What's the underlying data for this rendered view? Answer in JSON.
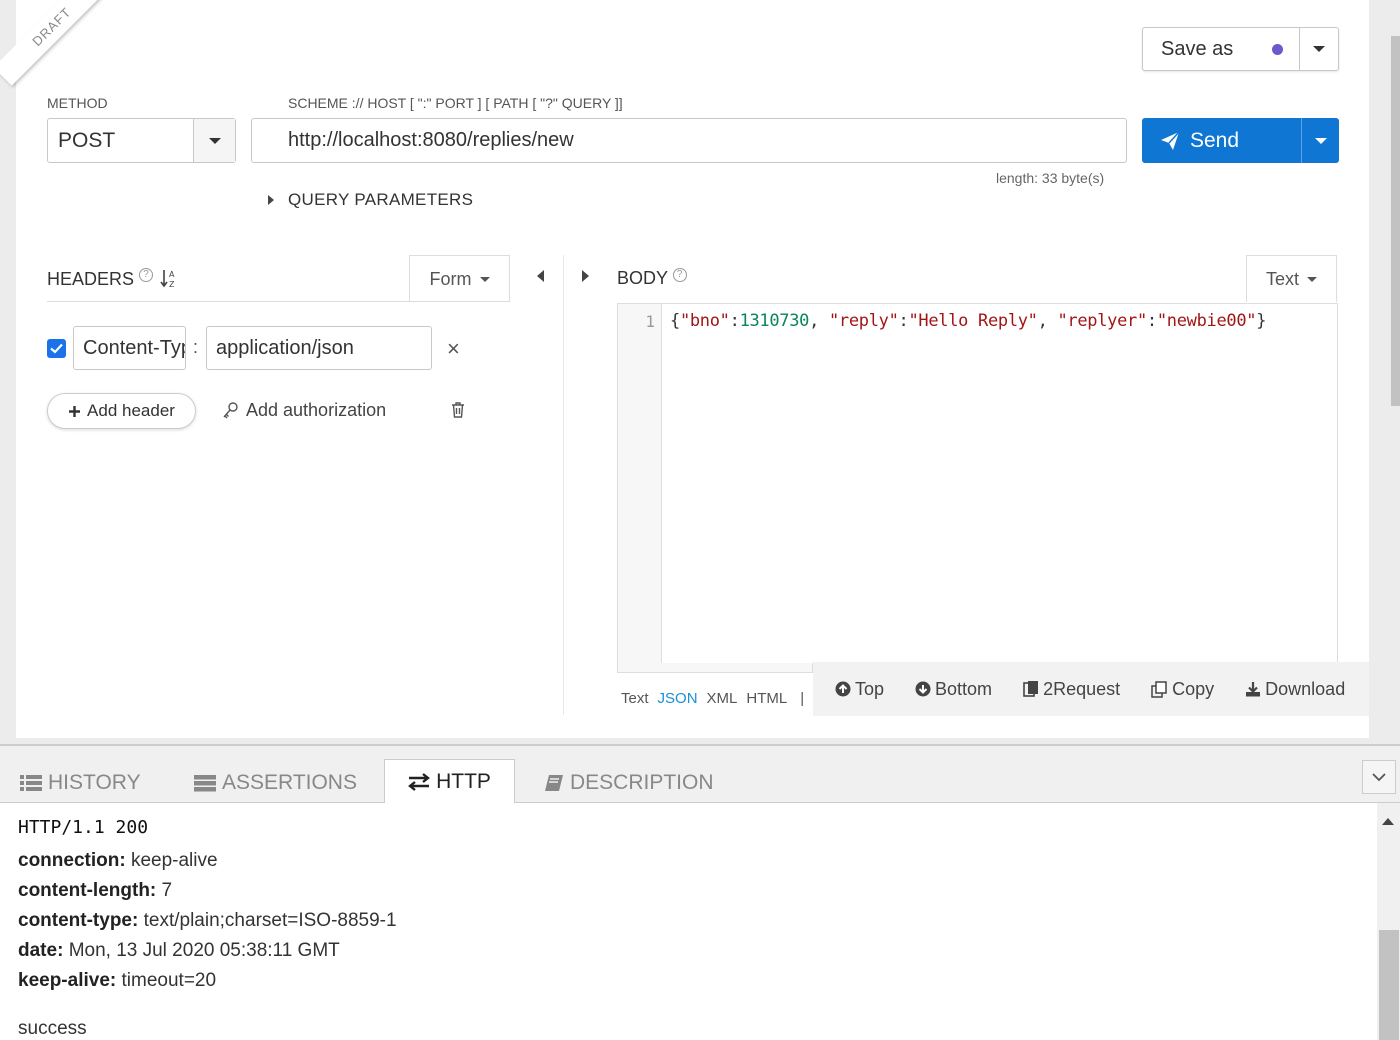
{
  "draft_label": "DRAFT",
  "save": {
    "label": "Save as",
    "dot_color": "#6a5acd"
  },
  "request": {
    "method_label": "METHOD",
    "method_value": "POST",
    "url_label": "SCHEME :// HOST [ \":\" PORT ] [ PATH [ \"?\" QUERY ]]",
    "url_value": "http://localhost:8080/replies/new",
    "length_text": "length: 33 byte(s)",
    "send_label": "Send",
    "query_params_label": "QUERY PARAMETERS"
  },
  "headers": {
    "title": "HEADERS",
    "help": "?",
    "form_label": "Form",
    "items": [
      {
        "checked": true,
        "name": "Content-Type",
        "value": "application/json"
      }
    ],
    "separator": ":",
    "remove_glyph": "×",
    "add_header_label": "Add header",
    "add_auth_label": "Add authorization"
  },
  "body": {
    "title": "BODY",
    "help": "?",
    "format_label": "Text",
    "line_number": "1",
    "code": {
      "p1": "{",
      "k1": "\"bno\"",
      "c1": ":",
      "v1": "1310730",
      "s1": ", ",
      "k2": "\"reply\"",
      "c2": ":",
      "v2": "\"Hello Reply\"",
      "s2": ", ",
      "k3": "\"replyer\"",
      "c3": ":",
      "v3": "\"newbie00\"",
      "p2": "}"
    },
    "modes": [
      "Text",
      "JSON",
      "XML",
      "HTML",
      "|"
    ],
    "active_mode": "JSON",
    "toolbar": {
      "top": "Top",
      "bottom": "Bottom",
      "to_request": "2Request",
      "copy": "Copy",
      "download": "Download"
    }
  },
  "tabs": {
    "history": "HISTORY",
    "assertions": "ASSERTIONS",
    "http": "HTTP",
    "description": "DESCRIPTION",
    "active": "HTTP"
  },
  "response": {
    "status_line": "HTTP/1.1 200",
    "headers": [
      {
        "name": "connection:",
        "value": "keep-alive"
      },
      {
        "name": "content-length:",
        "value": "7"
      },
      {
        "name": "content-type:",
        "value": "text/plain;charset=ISO-8859-1"
      },
      {
        "name": "date:",
        "value": "Mon, 13 Jul 2020 05:38:11 GMT"
      },
      {
        "name": "keep-alive:",
        "value": "timeout=20"
      }
    ],
    "body": "success"
  },
  "colors": {
    "accent": "#0f76d4",
    "json_link": "#1a8fd6",
    "string": "#a31515",
    "number": "#098658"
  }
}
